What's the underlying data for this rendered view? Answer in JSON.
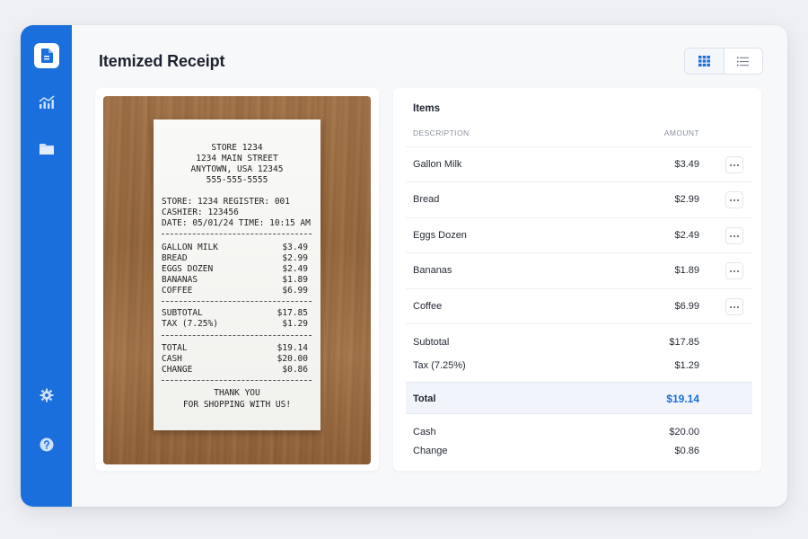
{
  "page": {
    "title": "Itemized Receipt"
  },
  "colors": {
    "accent": "#1a6fdc",
    "sidebar": "#1a6fdc",
    "total_band": "#f1f5fb"
  },
  "sidebar": {
    "items": [
      {
        "icon": "document-icon",
        "active": true
      },
      {
        "icon": "chart-icon",
        "active": false
      },
      {
        "icon": "folder-icon",
        "active": false
      },
      {
        "icon": "gear-icon",
        "active": false
      },
      {
        "icon": "help-icon",
        "active": false
      }
    ]
  },
  "view_toggle": {
    "options": [
      {
        "icon": "grid-icon",
        "active": true
      },
      {
        "icon": "list-icon",
        "active": false
      }
    ]
  },
  "receipt_image": {
    "header": [
      "STORE 1234",
      "1234 MAIN STREET",
      "ANYTOWN, USA 12345",
      "555-555-5555"
    ],
    "store_line": "STORE: 1234   REGISTER: 001",
    "cashier_line": "CASHIER: 123456",
    "date_line": "DATE: 05/01/24  TIME: 10:15 AM",
    "items": [
      {
        "name": "GALLON MILK",
        "price": "$3.49"
      },
      {
        "name": "BREAD",
        "price": "$2.99"
      },
      {
        "name": "EGGS DOZEN",
        "price": "$2.49"
      },
      {
        "name": "BANANAS",
        "price": "$1.89"
      },
      {
        "name": "COFFEE",
        "price": "$6.99"
      }
    ],
    "subtotal": {
      "label": "SUBTOTAL",
      "value": "$17.85"
    },
    "tax": {
      "label": "TAX (7.25%)",
      "value": "$1.29"
    },
    "total": {
      "label": "TOTAL",
      "value": "$19.14"
    },
    "cash": {
      "label": "CASH",
      "value": "$20.00"
    },
    "change": {
      "label": "CHANGE",
      "value": "$0.86"
    },
    "footer": [
      "THANK YOU",
      "FOR SHOPPING WITH US!"
    ]
  },
  "items_panel": {
    "title": "Items",
    "columns": {
      "description": "DESCRIPTION",
      "amount": "AMOUNT"
    },
    "rows": [
      {
        "description": "Gallon Milk",
        "amount": "$3.49"
      },
      {
        "description": "Bread",
        "amount": "$2.99"
      },
      {
        "description": "Eggs Dozen",
        "amount": "$2.49"
      },
      {
        "description": "Bananas",
        "amount": "$1.89"
      },
      {
        "description": "Coffee",
        "amount": "$6.99"
      }
    ],
    "subtotal": {
      "label": "Subtotal",
      "value": "$17.85"
    },
    "tax": {
      "label": "Tax (7.25%)",
      "value": "$1.29"
    },
    "total": {
      "label": "Total",
      "value": "$19.14"
    },
    "cash": {
      "label": "Cash",
      "value": "$20.00"
    },
    "change": {
      "label": "Change",
      "value": "$0.86"
    }
  }
}
